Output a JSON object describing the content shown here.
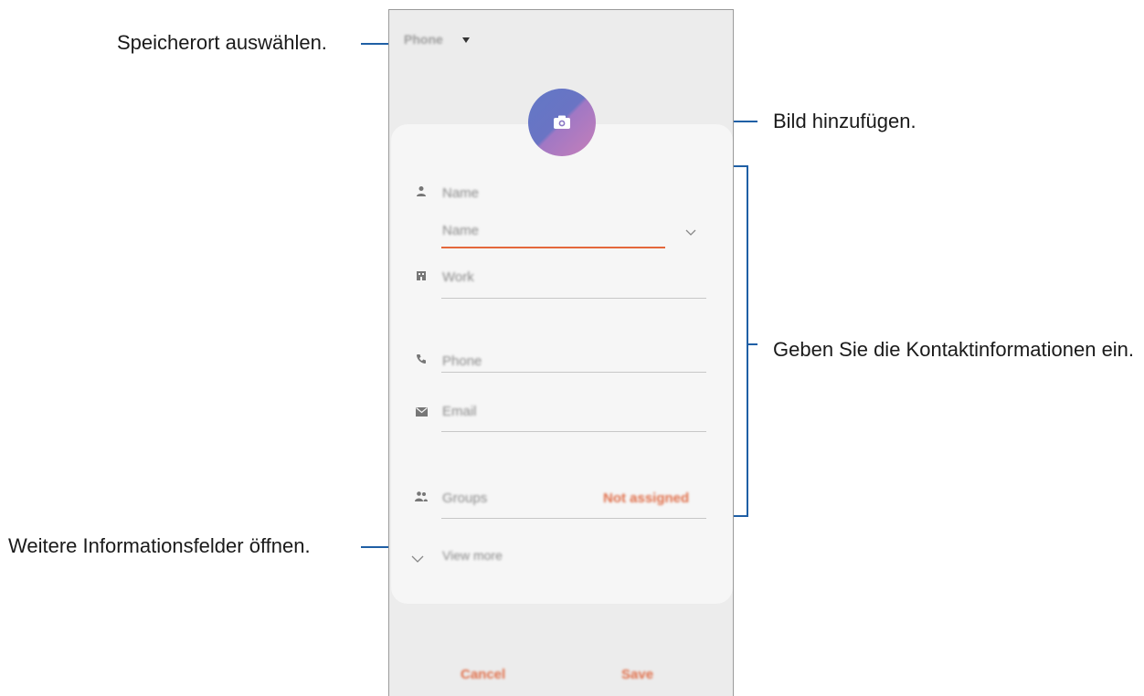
{
  "callouts": {
    "storage": "Speicherort auswählen.",
    "picture": "Bild hinzufügen.",
    "contact_info": "Geben Sie die Kontaktinformationen ein.",
    "more_fields": "Weitere Informationsfelder öffnen."
  },
  "phone": {
    "storage_label": "Phone",
    "fields": {
      "name_header": "Name",
      "name_input": "Name",
      "work": "Work",
      "phone": "Phone",
      "email": "Email",
      "groups": "Groups",
      "groups_value": "Not assigned",
      "view_more": "View more"
    },
    "buttons": {
      "cancel": "Cancel",
      "save": "Save"
    }
  },
  "colors": {
    "leader": "#1f5fa5",
    "accent": "#e06f4a",
    "avatar_start": "#6277c6",
    "avatar_end": "#c67fb9"
  }
}
